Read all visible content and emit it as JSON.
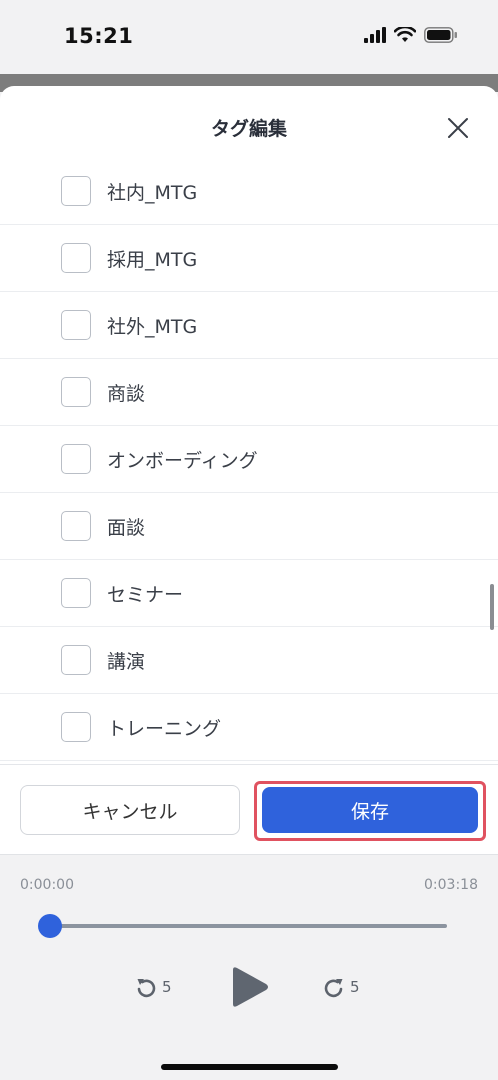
{
  "status": {
    "time": "15:21"
  },
  "sheet": {
    "title": "タグ編集"
  },
  "tags": [
    {
      "label": "社内_MTG",
      "checked": false
    },
    {
      "label": "採用_MTG",
      "checked": false
    },
    {
      "label": "社外_MTG",
      "checked": false
    },
    {
      "label": "商談",
      "checked": false
    },
    {
      "label": "オンボーディング",
      "checked": false
    },
    {
      "label": "面談",
      "checked": false
    },
    {
      "label": "セミナー",
      "checked": false
    },
    {
      "label": "講演",
      "checked": false
    },
    {
      "label": "トレーニング",
      "checked": false
    }
  ],
  "actions": {
    "cancel_label": "キャンセル",
    "save_label": "保存"
  },
  "player": {
    "current_time": "0:00:00",
    "total_time": "0:03:18",
    "progress": 0,
    "rewind_label": "5",
    "forward_label": "5"
  },
  "colors": {
    "accent": "#2f62dc",
    "highlight": "#e05260"
  },
  "icons": [
    "signal-icon",
    "wifi-icon",
    "battery-icon",
    "close-icon",
    "rewind-5-icon",
    "play-icon",
    "forward-5-icon"
  ]
}
